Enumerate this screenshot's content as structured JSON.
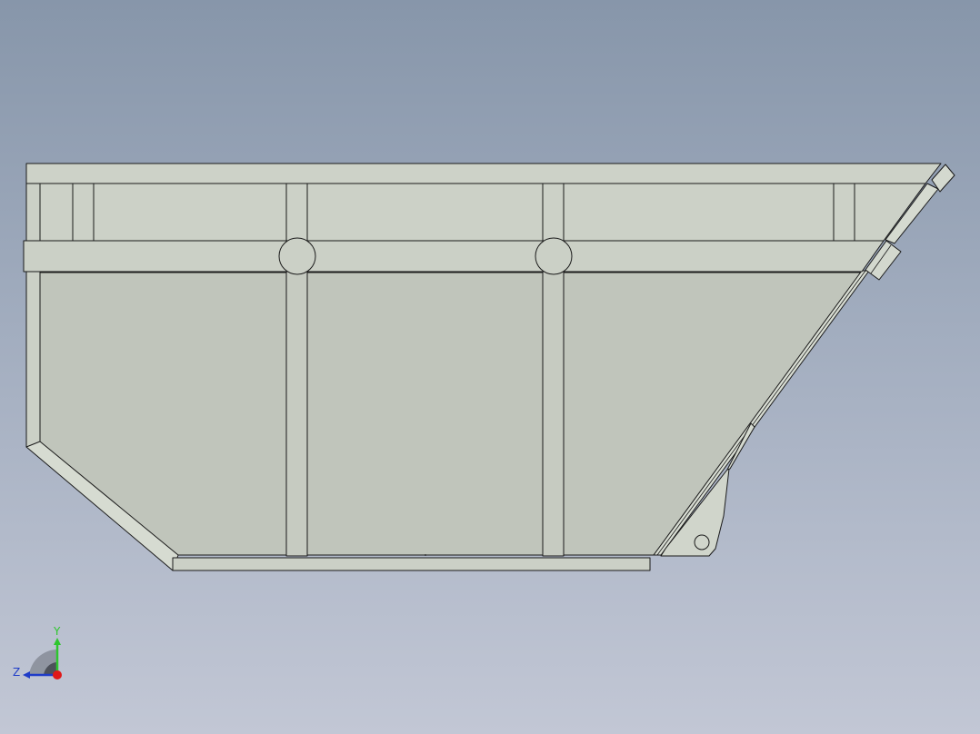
{
  "viewport": {
    "background_top": "#8796aa",
    "background_bottom": "#c2c7d5"
  },
  "model": {
    "name": "skip-container-side-view",
    "body_color": "#c0c5bb",
    "frame_color": "#cbd0c6",
    "light_edge_color": "#dadfd5",
    "outline_color": "#1a1a1a"
  },
  "triad": {
    "y_label": "Y",
    "z_label": "Z",
    "y_color": "#2ec62e",
    "z_color": "#1f3cc8",
    "x_color": "#e01818"
  }
}
